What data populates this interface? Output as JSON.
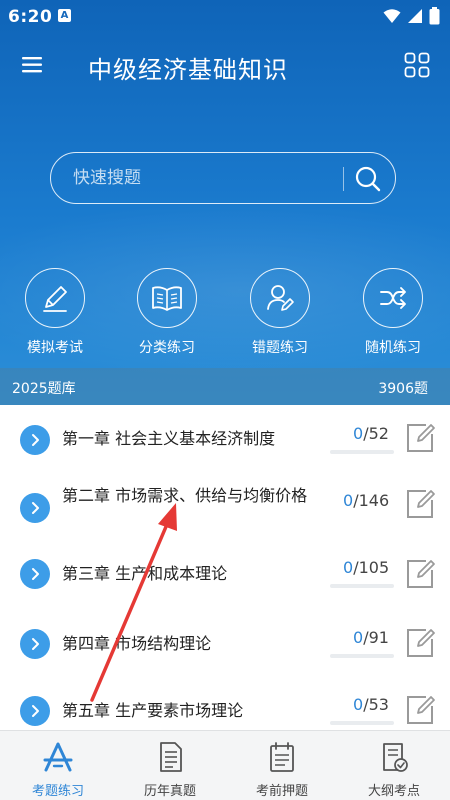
{
  "status_bar": {
    "time": "6:20",
    "notification_badge": "A"
  },
  "app": {
    "title": "中级经济基础知识"
  },
  "search": {
    "placeholder": "快速搜题"
  },
  "quick_actions": [
    {
      "label": "模拟考试",
      "icon": "pencil-icon"
    },
    {
      "label": "分类练习",
      "icon": "book-icon"
    },
    {
      "label": "错题练习",
      "icon": "person-edit-icon"
    },
    {
      "label": "随机练习",
      "icon": "shuffle-icon"
    }
  ],
  "bank": {
    "name": "2025题库",
    "count": "3906题"
  },
  "chapters": [
    {
      "title": "第一章 社会主义基本经济制度",
      "done": "0",
      "total": "/52"
    },
    {
      "title": "第二章 市场需求、供给与均衡价格",
      "done": "0",
      "total": "/146"
    },
    {
      "title": "第三章 生产和成本理论",
      "done": "0",
      "total": "/105"
    },
    {
      "title": "第四章 市场结构理论",
      "done": "0",
      "total": "/91"
    },
    {
      "title": "第五章 生产要素市场理论",
      "done": "0",
      "total": "/53"
    }
  ],
  "tabs": [
    {
      "label": "考题练习",
      "icon": "practice-icon",
      "active": true
    },
    {
      "label": "历年真题",
      "icon": "document-icon",
      "active": false
    },
    {
      "label": "考前押题",
      "icon": "calendar-icon",
      "active": false
    },
    {
      "label": "大纲考点",
      "icon": "syllabus-icon",
      "active": false
    }
  ],
  "colors": {
    "header": "#1668bb",
    "accent": "#2f86d6",
    "annotation_arrow": "#e53935"
  }
}
